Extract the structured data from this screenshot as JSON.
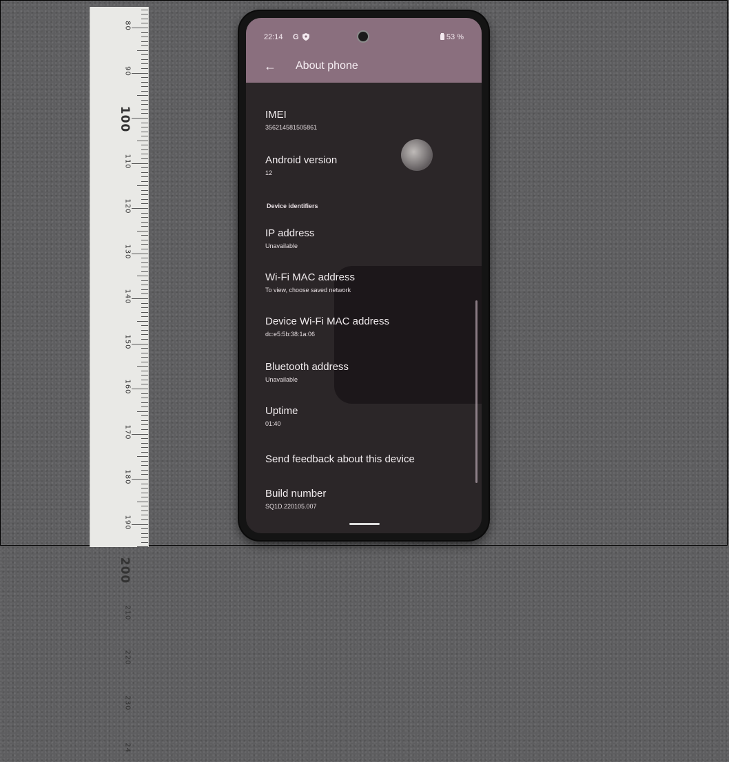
{
  "ruler": {
    "labels": [
      "80",
      "90",
      "100",
      "110",
      "120",
      "130",
      "140",
      "150",
      "160",
      "170",
      "180",
      "190",
      "200",
      "210",
      "220",
      "230",
      "24"
    ]
  },
  "status_bar": {
    "time": "22:14",
    "g_icon": "G",
    "battery": "53 %"
  },
  "app_bar": {
    "back_icon": "←",
    "title": "About phone"
  },
  "items": [
    {
      "title": "IMEI",
      "subtitle": "356214581505861"
    },
    {
      "title": "Android version",
      "subtitle": "12"
    },
    {
      "title": "IP address",
      "subtitle": "Unavailable"
    },
    {
      "title": "Wi-Fi MAC address",
      "subtitle": "To view, choose saved network"
    },
    {
      "title": "Device Wi-Fi MAC address",
      "subtitle": "dc:e5:5b:38:1a:06"
    },
    {
      "title": "Bluetooth address",
      "subtitle": "Unavailable"
    },
    {
      "title": "Uptime",
      "subtitle": "01:40"
    },
    {
      "title": "Send feedback about this device",
      "subtitle": ""
    },
    {
      "title": "Build number",
      "subtitle": "SQ1D.220105.007"
    }
  ],
  "section_header": "Device identifiers",
  "icons": {
    "status_shield": "shield-icon",
    "battery": "battery-icon",
    "camera": "camera-icon"
  }
}
